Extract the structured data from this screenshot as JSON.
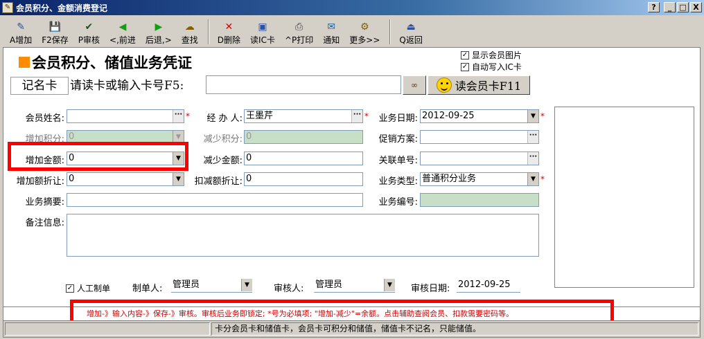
{
  "window": {
    "title": "会员积分、金额消费登记",
    "btn_help": "?",
    "btn_min": "_",
    "btn_max": "□",
    "btn_close": "X"
  },
  "toolbar": [
    {
      "label": "A增加",
      "icon": "✎",
      "color": "#3050a0"
    },
    {
      "label": "F2保存",
      "icon": "💾",
      "color": "#203080"
    },
    {
      "label": "P审核",
      "icon": "✔",
      "color": "#205020"
    },
    {
      "label": "<,前进",
      "icon": "◀",
      "color": "#10a010"
    },
    {
      "label": "后退,>",
      "icon": "▶",
      "color": "#10a010"
    },
    {
      "label": "查找",
      "icon": "☁",
      "color": "#806000"
    },
    {
      "label": "D删除",
      "icon": "✕",
      "color": "#e00000"
    },
    {
      "label": "读IC卡",
      "icon": "▣",
      "color": "#3050a0"
    },
    {
      "label": "^P打印",
      "icon": "⎙",
      "color": "#404040"
    },
    {
      "label": "通知",
      "icon": "✉",
      "color": "#2060a0"
    },
    {
      "label": "更多>>",
      "icon": "⚙",
      "color": "#806000"
    },
    {
      "label": "Q返回",
      "icon": "⏏",
      "color": "#3050a0"
    }
  ],
  "header": {
    "title": "会员积分、储值业务凭证",
    "show_photo": "显示会员图片",
    "auto_write_ic": "自动写入IC卡",
    "check_mark": "✓"
  },
  "card": {
    "type": "记名卡",
    "prompt": "请读卡或输入卡号F5:",
    "value": "",
    "read_button": "读会员卡F11"
  },
  "form": {
    "member_name": {
      "label": "会员姓名:",
      "value": ""
    },
    "handler": {
      "label": "经 办 人:",
      "value": "王墨芹"
    },
    "biz_date": {
      "label": "业务日期:",
      "value": "2012-09-25"
    },
    "add_points": {
      "label": "增加积分:",
      "value": "0"
    },
    "reduce_points": {
      "label": "减少积分:",
      "value": "0"
    },
    "promo": {
      "label": "促销方案:",
      "value": ""
    },
    "add_amount": {
      "label": "增加金额:",
      "value": "0"
    },
    "reduce_amount": {
      "label": "减少金额:",
      "value": "0"
    },
    "related_no": {
      "label": "关联单号:",
      "value": ""
    },
    "add_discount": {
      "label": "增加额折让:",
      "value": "0"
    },
    "deduct_discount": {
      "label": "扣减额折让:",
      "value": "0"
    },
    "biz_type": {
      "label": "业务类型:",
      "value": "普通积分业务"
    },
    "summary": {
      "label": "业务摘要:",
      "value": ""
    },
    "biz_no": {
      "label": "业务编号:",
      "value": ""
    },
    "remarks": {
      "label": "备注信息:",
      "value": ""
    }
  },
  "footer": {
    "manual": "人工制单",
    "maker_label": "制单人:",
    "maker": "管理员",
    "auditor_label": "审核人:",
    "auditor": "管理员",
    "audit_date_label": "审核日期:",
    "audit_date": "2012-09-25"
  },
  "hint": "增加-》输入内容-》保存-》审核。审核后业务即锁定; *号为必填项; \"增加-减少\"=余额。点击辅助查阅会员、扣款需要密码等。",
  "status": "卡分会员卡和储值卡，会员卡可积分和储值，储值卡不记名，只能储值。",
  "symbols": {
    "ellipsis": "···",
    "dropdown": "▼",
    "required": "*"
  }
}
